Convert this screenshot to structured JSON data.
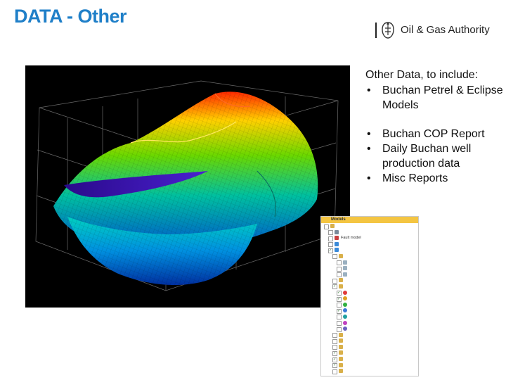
{
  "slide": {
    "title": "DATA - Other"
  },
  "logo": {
    "name": "Oil & Gas Authority"
  },
  "content": {
    "intro": "Other Data, to include:",
    "bullets_group1": [
      "Buchan Petrel & Eclipse Models"
    ],
    "bullets_group2": [
      "Buchan COP Report",
      "Daily Buchan well production data",
      "Misc Reports"
    ]
  },
  "colors": {
    "title": "#1f7fc8",
    "tree_header": "#f4c542",
    "viz_background": "#000000"
  },
  "tree_panel": {
    "header": "Models",
    "rows": [
      {
        "label": "",
        "icon": "folder",
        "checked": false
      },
      {
        "label": "",
        "icon": "model",
        "checked": false
      },
      {
        "label": "Fault model",
        "icon": "fault",
        "checked": false
      },
      {
        "label": "",
        "icon": "grid",
        "checked": false
      },
      {
        "label": "",
        "icon": "grid",
        "checked": true
      },
      {
        "label": "",
        "icon": "folder",
        "checked": false
      },
      {
        "label": "",
        "icon": "layer",
        "checked": false
      },
      {
        "label": "",
        "icon": "layer",
        "checked": false
      },
      {
        "label": "",
        "icon": "layer",
        "checked": false
      },
      {
        "label": "",
        "icon": "folder",
        "checked": false
      },
      {
        "label": "",
        "icon": "folder",
        "checked": true
      },
      {
        "label": "",
        "icon": "surface",
        "checked": true
      },
      {
        "label": "",
        "icon": "surface",
        "checked": true
      },
      {
        "label": "",
        "icon": "surface",
        "checked": false
      },
      {
        "label": "",
        "icon": "surface",
        "checked": true
      },
      {
        "label": "",
        "icon": "surface",
        "checked": false
      },
      {
        "label": "",
        "icon": "surface",
        "checked": false
      },
      {
        "label": "",
        "icon": "surface",
        "checked": false
      },
      {
        "label": "",
        "icon": "folder",
        "checked": false
      },
      {
        "label": "",
        "icon": "folder",
        "checked": false
      },
      {
        "label": "",
        "icon": "folder",
        "checked": false
      },
      {
        "label": "",
        "icon": "folder",
        "checked": true
      },
      {
        "label": "",
        "icon": "folder",
        "checked": true
      },
      {
        "label": "",
        "icon": "folder",
        "checked": true
      },
      {
        "label": "",
        "icon": "folder",
        "checked": false
      }
    ]
  }
}
